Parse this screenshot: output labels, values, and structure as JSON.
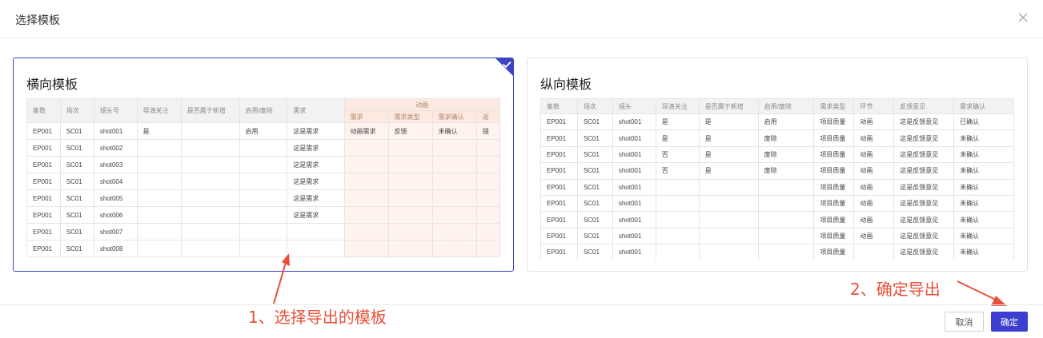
{
  "dialog": {
    "title": "选择模板"
  },
  "templates": {
    "horizontal": {
      "title": "横向模板",
      "selected": true,
      "headers": [
        "集数",
        "场次",
        "镜头号",
        "导演关注",
        "是否属于新增",
        "启用/废除",
        "需求"
      ],
      "group_header": "动画",
      "sub_headers": [
        "需求",
        "需求类型",
        "需求确认",
        "返"
      ],
      "rows": [
        [
          "EP001",
          "SC01",
          "shot001",
          "是",
          "",
          "启用",
          "这是需求",
          "动画需求",
          "反馈",
          "未确认",
          "镜"
        ],
        [
          "EP001",
          "SC01",
          "shot002",
          "",
          "",
          "",
          "这是需求",
          "",
          "",
          "",
          ""
        ],
        [
          "EP001",
          "SC01",
          "shot003",
          "",
          "",
          "",
          "这是需求",
          "",
          "",
          "",
          ""
        ],
        [
          "EP001",
          "SC01",
          "shot004",
          "",
          "",
          "",
          "这是需求",
          "",
          "",
          "",
          ""
        ],
        [
          "EP001",
          "SC01",
          "shot005",
          "",
          "",
          "",
          "这是需求",
          "",
          "",
          "",
          ""
        ],
        [
          "EP001",
          "SC01",
          "shot006",
          "",
          "",
          "",
          "这是需求",
          "",
          "",
          "",
          ""
        ],
        [
          "EP001",
          "SC01",
          "shot007",
          "",
          "",
          "",
          "",
          "",
          "",
          "",
          ""
        ],
        [
          "EP001",
          "SC01",
          "shot008",
          "",
          "",
          "",
          "",
          "",
          "",
          "",
          ""
        ]
      ]
    },
    "vertical": {
      "title": "纵向模板",
      "selected": false,
      "headers": [
        "集数",
        "场次",
        "镜头",
        "导演关注",
        "是否属于新增",
        "启用/废除",
        "需求类型",
        "环节",
        "反馈意见",
        "需求确认"
      ],
      "rows": [
        [
          "EP001",
          "SC01",
          "shot001",
          "是",
          "是",
          "启用",
          "项目质量",
          "动画",
          "这是反馈意见",
          "已确认"
        ],
        [
          "EP001",
          "SC01",
          "shot001",
          "是",
          "是",
          "废除",
          "项目质量",
          "动画",
          "这是反馈意见",
          "未确认"
        ],
        [
          "EP001",
          "SC01",
          "shot001",
          "否",
          "是",
          "废除",
          "项目质量",
          "动画",
          "这是反馈意见",
          "未确认"
        ],
        [
          "EP001",
          "SC01",
          "shot001",
          "否",
          "是",
          "废除",
          "项目质量",
          "动画",
          "这是反馈意见",
          "未确认"
        ],
        [
          "EP001",
          "SC01",
          "shot001",
          "",
          "",
          "",
          "项目质量",
          "动画",
          "这是反馈意见",
          "未确认"
        ],
        [
          "EP001",
          "SC01",
          "shot001",
          "",
          "",
          "",
          "项目质量",
          "动画",
          "这是反馈意见",
          "未确认"
        ],
        [
          "EP001",
          "SC01",
          "shot001",
          "",
          "",
          "",
          "项目质量",
          "动画",
          "这是反馈意见",
          "未确认"
        ],
        [
          "EP001",
          "SC01",
          "shot001",
          "",
          "",
          "",
          "项目质量",
          "动画",
          "这是反馈意见",
          "未确认"
        ],
        [
          "EP001",
          "SC01",
          "shot001",
          "",
          "",
          "",
          "项目质量",
          "",
          "这是反馈意见",
          "未确认"
        ]
      ]
    }
  },
  "annotations": {
    "step1": "1、选择导出的模板",
    "step2": "2、确定导出",
    "color": "#e8503a"
  },
  "footer": {
    "cancel_label": "取消",
    "ok_label": "确定"
  },
  "colors": {
    "accent": "#3d3fd1",
    "group_header_bg": "#fde9e0"
  },
  "icons": {
    "close": "close-icon",
    "selected": "checkmark-icon"
  }
}
